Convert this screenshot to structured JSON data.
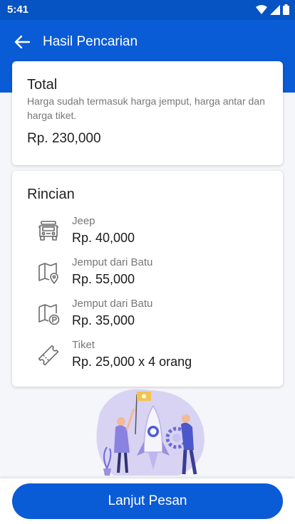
{
  "status_bar": {
    "time": "5:41"
  },
  "header": {
    "title": "Hasil Pencarian"
  },
  "total": {
    "title": "Total",
    "description": "Harga sudah termasuk harga jemput, harga antar dan harga tiket.",
    "price": "Rp. 230,000"
  },
  "details": {
    "title": "Rincian",
    "items": [
      {
        "icon": "jeep-icon",
        "label": "Jeep",
        "value": "Rp. 40,000"
      },
      {
        "icon": "map-pin-icon",
        "label": "Jemput dari Batu",
        "value": "Rp. 55,000"
      },
      {
        "icon": "map-parking-icon",
        "label": "Jemput dari Batu",
        "value": "Rp. 35,000"
      },
      {
        "icon": "ticket-icon",
        "label": "Tiket",
        "value": "Rp. 25,000 x 4 orang"
      }
    ]
  },
  "footer": {
    "button_label": "Lanjut Pesan"
  },
  "colors": {
    "primary": "#0a5bd6",
    "status_bar": "#0653c4",
    "background": "#f4f6f9",
    "illustration": "#c9c3ee"
  }
}
